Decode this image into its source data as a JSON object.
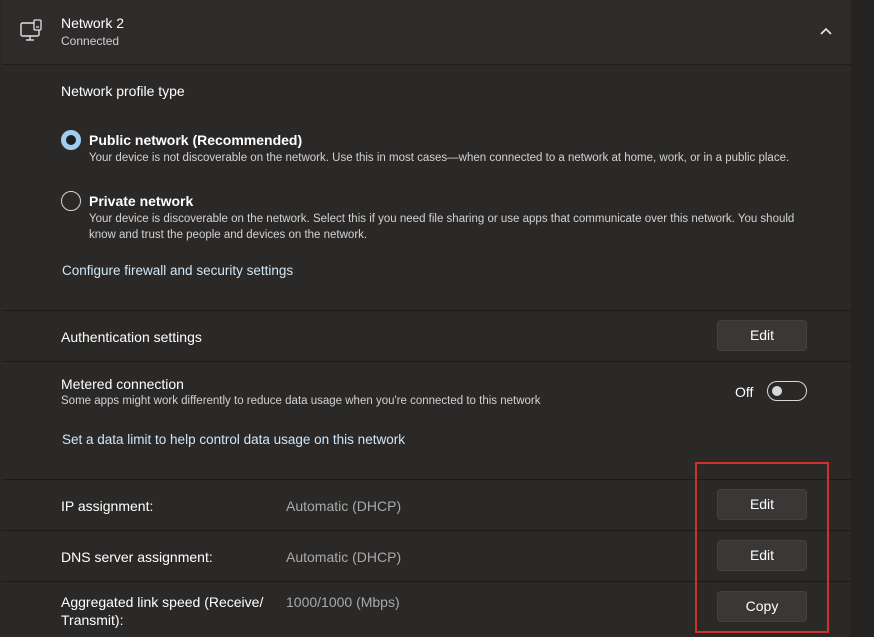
{
  "header": {
    "title": "Network 2",
    "subtitle": "Connected",
    "icon": "network-monitor-icon",
    "collapse_icon": "chevron-up-icon"
  },
  "profile": {
    "title": "Network profile type",
    "options": [
      {
        "label": "Public network (Recommended)",
        "description": "Your device is not discoverable on the network. Use this in most cases—when connected to a network at home, work, or in a public place.",
        "selected": true
      },
      {
        "label": "Private network",
        "description": "Your device is discoverable on the network. Select this if you need file sharing or use apps that communicate over this network. You should know and trust the people and devices on the network.",
        "selected": false
      }
    ],
    "firewall_link": "Configure firewall and security settings"
  },
  "authentication": {
    "label": "Authentication settings",
    "button": "Edit"
  },
  "metered": {
    "label": "Metered connection",
    "description": "Some apps might work differently to reduce data usage when you're connected to this network",
    "toggle_state": "Off",
    "data_limit_link": "Set a data limit to help control data usage on this network"
  },
  "ip_assignment": {
    "label": "IP assignment:",
    "value": "Automatic (DHCP)",
    "button": "Edit"
  },
  "dns_assignment": {
    "label": "DNS server assignment:",
    "value": "Automatic (DHCP)",
    "button": "Edit"
  },
  "link_speed": {
    "label_line1": "Aggregated link speed (Receive/",
    "label_line2": "Transmit):",
    "value": "1000/1000 (Mbps)",
    "button": "Copy"
  },
  "colors": {
    "accent": "#9ecdf0",
    "highlight": "#d0312d",
    "background": "#2b2928"
  }
}
